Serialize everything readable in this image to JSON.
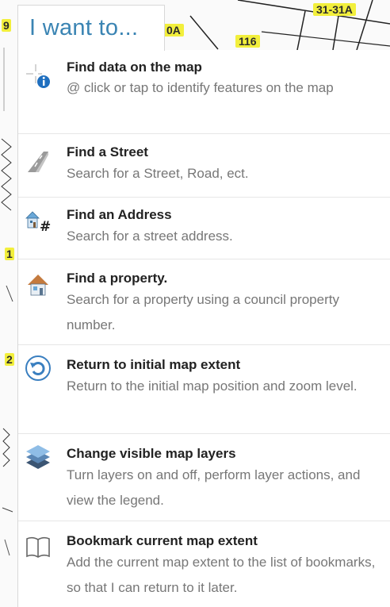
{
  "trigger": {
    "label": "I want to..."
  },
  "map": {
    "labels": [
      "9",
      "0A",
      "116",
      "31-31A",
      "1",
      "2"
    ]
  },
  "menu": {
    "items": [
      {
        "title": "Find data on the map",
        "desc": "@ click or tap to identify features on the map",
        "icon": "identify-icon"
      },
      {
        "title": "Find a Street",
        "desc": "Search for a Street, Road, ect.",
        "icon": "road-icon"
      },
      {
        "title": "Find an Address",
        "desc": "Search for a street address.",
        "icon": "address-icon"
      },
      {
        "title": "Find a property.",
        "desc": "Search for a property using a council property number.",
        "icon": "house-icon"
      },
      {
        "title": "Return to initial map extent",
        "desc": "Return to the initial map position and zoom level.",
        "icon": "reset-icon"
      },
      {
        "title": "Change visible map layers",
        "desc": "Turn layers on and off, perform layer actions, and view the legend.",
        "icon": "layers-icon"
      },
      {
        "title": "Bookmark current map extent",
        "desc": "Add the current map extent to the list of bookmarks, so that I can return to it later.",
        "icon": "bookmark-icon"
      }
    ]
  },
  "colors": {
    "accent": "#3a84b3",
    "map_label": "#f2ef3c",
    "title_text": "#222222",
    "desc_text": "#777777"
  }
}
